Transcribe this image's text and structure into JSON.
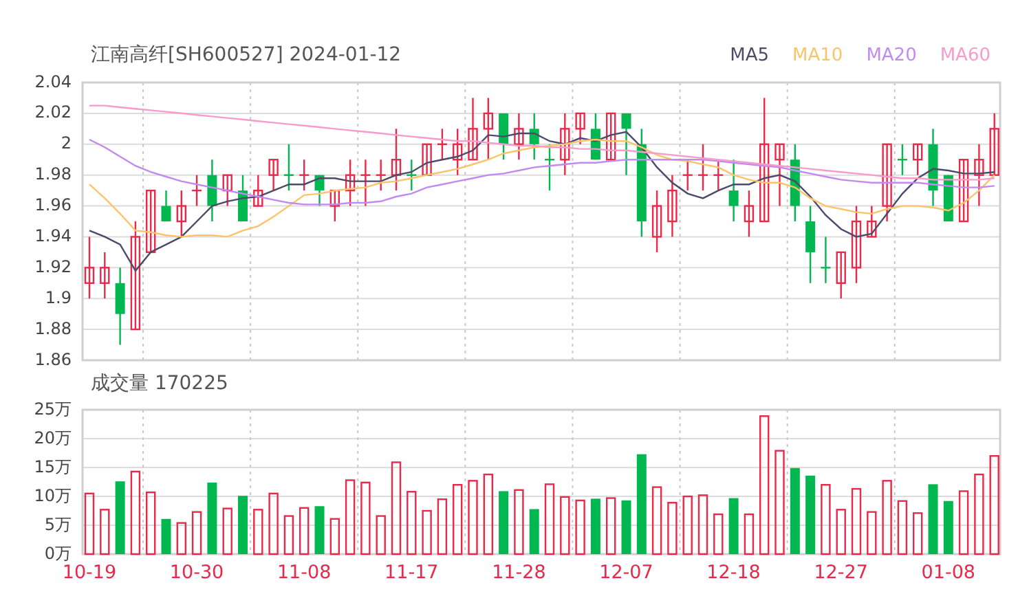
{
  "price_panel": {
    "title": "江南高纤[SH600527] 2024-01-12",
    "chart_data": {
      "type": "candlestick",
      "grid": true,
      "ylim": [
        1.86,
        2.04
      ],
      "yticks": [
        {
          "value": 2.04,
          "label": "2.04"
        },
        {
          "value": 2.02,
          "label": "2.02"
        },
        {
          "value": 2.0,
          "label": "2"
        },
        {
          "value": 1.98,
          "label": "1.98"
        },
        {
          "value": 1.96,
          "label": "1.96"
        },
        {
          "value": 1.94,
          "label": "1.94"
        },
        {
          "value": 1.92,
          "label": "1.92"
        },
        {
          "value": 1.9,
          "label": "1.9"
        },
        {
          "value": 1.88,
          "label": "1.88"
        },
        {
          "value": 1.86,
          "label": "1.86"
        }
      ],
      "ohlc": [
        [
          1.91,
          1.94,
          1.9,
          1.92
        ],
        [
          1.91,
          1.93,
          1.9,
          1.92
        ],
        [
          1.91,
          1.92,
          1.87,
          1.89
        ],
        [
          1.88,
          1.95,
          1.88,
          1.94
        ],
        [
          1.93,
          1.97,
          1.93,
          1.97
        ],
        [
          1.96,
          1.97,
          1.95,
          1.95
        ],
        [
          1.95,
          1.97,
          1.94,
          1.96
        ],
        [
          1.97,
          1.98,
          1.96,
          1.97
        ],
        [
          1.98,
          1.99,
          1.95,
          1.96
        ],
        [
          1.97,
          1.98,
          1.96,
          1.98
        ],
        [
          1.97,
          1.98,
          1.95,
          1.95
        ],
        [
          1.96,
          1.98,
          1.96,
          1.97
        ],
        [
          1.98,
          1.99,
          1.97,
          1.99
        ],
        [
          1.98,
          2.0,
          1.97,
          1.98
        ],
        [
          1.98,
          1.99,
          1.97,
          1.98
        ],
        [
          1.98,
          1.98,
          1.96,
          1.97
        ],
        [
          1.96,
          1.97,
          1.95,
          1.97
        ],
        [
          1.97,
          1.99,
          1.96,
          1.98
        ],
        [
          1.98,
          1.99,
          1.96,
          1.98
        ],
        [
          1.98,
          1.99,
          1.97,
          1.98
        ],
        [
          1.98,
          2.01,
          1.97,
          1.99
        ],
        [
          1.98,
          1.99,
          1.97,
          1.98
        ],
        [
          1.98,
          2.0,
          1.98,
          2.0
        ],
        [
          2.0,
          2.01,
          1.99,
          2.0
        ],
        [
          1.99,
          2.01,
          1.98,
          2.0
        ],
        [
          1.99,
          2.03,
          1.99,
          2.01
        ],
        [
          2.01,
          2.03,
          1.99,
          2.02
        ],
        [
          2.02,
          2.02,
          1.99,
          2.0
        ],
        [
          2.0,
          2.02,
          1.99,
          2.01
        ],
        [
          2.01,
          2.02,
          1.99,
          2.0
        ],
        [
          1.99,
          2.0,
          1.97,
          1.99
        ],
        [
          1.99,
          2.02,
          1.98,
          2.01
        ],
        [
          2.01,
          2.02,
          2.0,
          2.02
        ],
        [
          2.01,
          2.02,
          1.99,
          1.99
        ],
        [
          1.99,
          2.02,
          1.99,
          2.02
        ],
        [
          2.02,
          2.02,
          1.98,
          2.01
        ],
        [
          2.0,
          2.01,
          1.94,
          1.95
        ],
        [
          1.94,
          1.97,
          1.93,
          1.96
        ],
        [
          1.95,
          1.98,
          1.94,
          1.97
        ],
        [
          1.98,
          1.99,
          1.97,
          1.98
        ],
        [
          1.98,
          2.0,
          1.97,
          1.98
        ],
        [
          1.98,
          1.99,
          1.97,
          1.98
        ],
        [
          1.97,
          1.99,
          1.95,
          1.96
        ],
        [
          1.95,
          1.97,
          1.94,
          1.96
        ],
        [
          1.95,
          2.03,
          1.95,
          2.0
        ],
        [
          1.99,
          2.0,
          1.96,
          2.0
        ],
        [
          1.99,
          2.0,
          1.95,
          1.96
        ],
        [
          1.95,
          1.96,
          1.91,
          1.93
        ],
        [
          1.92,
          1.94,
          1.91,
          1.92
        ],
        [
          1.91,
          1.93,
          1.9,
          1.93
        ],
        [
          1.92,
          1.96,
          1.91,
          1.95
        ],
        [
          1.94,
          1.96,
          1.94,
          1.95
        ],
        [
          1.96,
          2.0,
          1.95,
          2.0
        ],
        [
          1.99,
          2.0,
          1.98,
          1.99
        ],
        [
          1.99,
          2.0,
          1.98,
          2.0
        ],
        [
          2.0,
          2.01,
          1.96,
          1.97
        ],
        [
          1.98,
          1.98,
          1.95,
          1.95
        ],
        [
          1.95,
          1.99,
          1.95,
          1.99
        ],
        [
          1.98,
          2.0,
          1.96,
          1.99
        ],
        [
          1.98,
          2.02,
          1.98,
          2.01
        ]
      ],
      "series": [
        {
          "name": "MA5",
          "type": "line",
          "color": "#4b4a6b",
          "values": [
            1.944,
            1.94,
            1.935,
            1.918,
            1.93,
            1.935,
            1.94,
            1.95,
            1.96,
            1.963,
            1.965,
            1.966,
            1.97,
            1.974,
            1.974,
            1.978,
            1.978,
            1.976,
            1.976,
            1.976,
            1.98,
            1.982,
            1.988,
            1.99,
            1.992,
            1.996,
            2.006,
            2.005,
            2.007,
            2.007,
            2.002,
            2.0,
            2.004,
            2.002,
            2.006,
            2.008,
            1.998,
            1.985,
            1.975,
            1.968,
            1.965,
            1.97,
            1.974,
            1.974,
            1.978,
            1.98,
            1.976,
            1.966,
            1.954,
            1.945,
            1.94,
            1.942,
            1.955,
            1.968,
            1.978,
            1.984,
            1.983,
            1.981,
            1.981,
            1.982
          ]
        },
        {
          "name": "MA10",
          "type": "line",
          "color": "#fbc46a",
          "values": [
            1.974,
            1.965,
            1.955,
            1.944,
            1.943,
            1.941,
            1.94,
            1.941,
            1.941,
            1.94,
            1.944,
            1.947,
            1.953,
            1.96,
            1.967,
            1.968,
            1.97,
            1.971,
            1.972,
            1.975,
            1.976,
            1.978,
            1.98,
            1.982,
            1.984,
            1.987,
            1.99,
            1.994,
            1.996,
            1.998,
            1.999,
            2.0,
            2.002,
            2.003,
            2.002,
            2.002,
            1.998,
            1.993,
            1.99,
            1.989,
            1.987,
            1.985,
            1.98,
            1.977,
            1.975,
            1.975,
            1.972,
            1.965,
            1.96,
            1.958,
            1.956,
            1.955,
            1.958,
            1.96,
            1.96,
            1.959,
            1.957,
            1.962,
            1.97,
            1.98
          ]
        },
        {
          "name": "MA20",
          "type": "line",
          "color": "#c18af0",
          "values": [
            2.003,
            1.998,
            1.992,
            1.986,
            1.982,
            1.979,
            1.976,
            1.974,
            1.972,
            1.97,
            1.968,
            1.966,
            1.964,
            1.962,
            1.961,
            1.961,
            1.961,
            1.962,
            1.962,
            1.963,
            1.966,
            1.968,
            1.972,
            1.974,
            1.976,
            1.978,
            1.98,
            1.981,
            1.983,
            1.985,
            1.986,
            1.987,
            1.988,
            1.988,
            1.989,
            1.99,
            1.99,
            1.99,
            1.99,
            1.99,
            1.99,
            1.989,
            1.988,
            1.987,
            1.986,
            1.985,
            1.983,
            1.981,
            1.979,
            1.977,
            1.976,
            1.975,
            1.975,
            1.975,
            1.975,
            1.974,
            1.973,
            1.972,
            1.972,
            1.973
          ]
        },
        {
          "name": "MA60",
          "type": "line",
          "color": "#f79bcb",
          "values": [
            2.025,
            2.025,
            2.024,
            2.023,
            2.022,
            2.021,
            2.02,
            2.019,
            2.018,
            2.017,
            2.016,
            2.015,
            2.014,
            2.013,
            2.012,
            2.011,
            2.01,
            2.009,
            2.008,
            2.007,
            2.006,
            2.005,
            2.004,
            2.003,
            2.002,
            2.002,
            2.001,
            2.0,
            1.999,
            1.999,
            1.998,
            1.998,
            1.997,
            1.997,
            1.996,
            1.996,
            1.995,
            1.994,
            1.993,
            1.992,
            1.991,
            1.99,
            1.989,
            1.988,
            1.987,
            1.986,
            1.985,
            1.984,
            1.983,
            1.982,
            1.981,
            1.98,
            1.979,
            1.978,
            1.978,
            1.977,
            1.977,
            1.977,
            1.977,
            1.978
          ]
        }
      ]
    }
  },
  "volume_panel": {
    "title": "成交量 170225",
    "chart_data": {
      "type": "bar",
      "grid": true,
      "categories": [
        "10-19",
        null,
        null,
        null,
        null,
        null,
        null,
        "10-30",
        null,
        null,
        null,
        null,
        null,
        null,
        "11-08",
        null,
        null,
        null,
        null,
        null,
        null,
        "11-17",
        null,
        null,
        null,
        null,
        null,
        null,
        "11-28",
        null,
        null,
        null,
        null,
        null,
        null,
        "12-07",
        null,
        null,
        null,
        null,
        null,
        null,
        "12-18",
        null,
        null,
        null,
        null,
        null,
        null,
        "12-27",
        null,
        null,
        null,
        null,
        null,
        null,
        "01-08",
        null,
        null,
        null
      ],
      "ylim": [
        0,
        25
      ],
      "yticks": [
        {
          "value": 25,
          "label": "25万"
        },
        {
          "value": 20,
          "label": "20万"
        },
        {
          "value": 15,
          "label": "15万"
        },
        {
          "value": 10,
          "label": "10万"
        },
        {
          "value": 5,
          "label": "5万"
        },
        {
          "value": 0,
          "label": "0万"
        }
      ],
      "values": [
        10.5,
        7.7,
        12.6,
        14.3,
        10.7,
        6.1,
        5.4,
        7.3,
        12.4,
        7.9,
        10.1,
        7.7,
        10.5,
        6.6,
        8.0,
        8.3,
        6.1,
        12.8,
        12.4,
        6.6,
        15.9,
        10.8,
        7.5,
        9.5,
        12.0,
        12.7,
        13.8,
        10.9,
        11.1,
        7.8,
        12.1,
        9.9,
        9.3,
        9.6,
        9.7,
        9.3,
        17.3,
        11.6,
        8.9,
        10.0,
        10.2,
        6.9,
        9.7,
        6.9,
        23.9,
        17.9,
        14.9,
        13.6,
        12.0,
        7.7,
        11.3,
        7.3,
        12.7,
        9.2,
        7.1,
        12.1,
        9.2,
        10.9,
        13.8,
        17.0
      ]
    }
  }
}
